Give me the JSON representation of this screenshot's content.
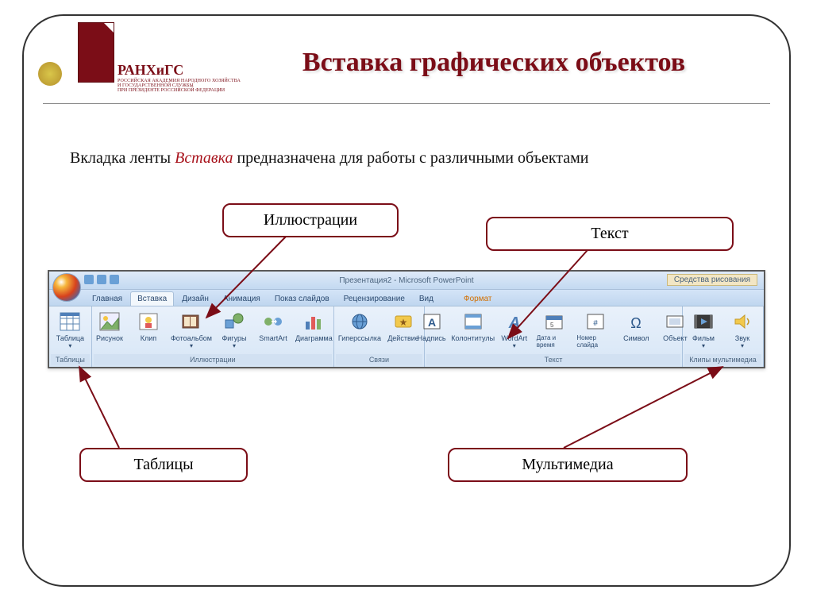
{
  "logo": {
    "text": "РАНХиГС"
  },
  "title": "Вставка графических объектов",
  "description": {
    "pre": "Вкладка ленты ",
    "keyword": "Вставка",
    "post": " предназначена для работы  с различными объектами"
  },
  "callouts": {
    "illustrations": "Иллюстрации",
    "text": "Текст",
    "tables": "Таблицы",
    "multimedia": "Мультимедиа"
  },
  "ribbon": {
    "app_title": "Презентация2 - Microsoft PowerPoint",
    "context_title": "Средства рисования",
    "tabs": [
      "Главная",
      "Вставка",
      "Дизайн",
      "Анимация",
      "Показ слайдов",
      "Рецензирование",
      "Вид"
    ],
    "active_tab": "Вставка",
    "format_tab": "Формат",
    "groups": {
      "tables": {
        "label": "Таблицы",
        "buttons": [
          "Таблица"
        ]
      },
      "illustrations": {
        "label": "Иллюстрации",
        "buttons": [
          "Рисунок",
          "Клип",
          "Фотоальбом",
          "Фигуры",
          "SmartArt",
          "Диаграмма"
        ]
      },
      "links": {
        "label": "Связи",
        "buttons": [
          "Гиперссылка",
          "Действие"
        ]
      },
      "text": {
        "label": "Текст",
        "buttons": [
          "Надпись",
          "Колонтитулы",
          "WordArt",
          "Дата и время",
          "Номер слайда",
          "Символ",
          "Объект"
        ]
      },
      "media": {
        "label": "Клипы мультимедиа",
        "buttons": [
          "Фильм",
          "Звук"
        ]
      }
    }
  }
}
